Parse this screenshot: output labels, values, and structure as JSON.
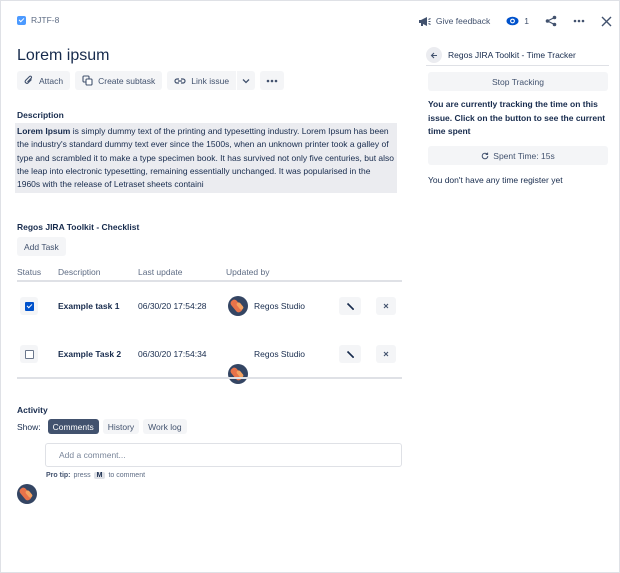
{
  "issue": {
    "key": "RJTF-8",
    "title": "Lorem ipsum"
  },
  "topbar": {
    "feedback_label": "Give feedback",
    "watch_count": "1"
  },
  "actions": {
    "attach": "Attach",
    "create_subtask": "Create subtask",
    "link_issue": "Link issue"
  },
  "description": {
    "heading": "Description",
    "bold_lead": "Lorem Ipsum",
    "body": " is simply dummy text of the printing and typesetting industry. Lorem Ipsum has been the industry's standard dummy text ever since the 1500s, when an unknown printer took a galley of type and scrambled it to make a type specimen book. It has survived not only five centuries, but also the leap into electronic typesetting, remaining essentially unchanged. It was popularised in the 1960s with the release of Letraset sheets containi"
  },
  "checklist": {
    "heading": "Regos JIRA Toolkit - Checklist",
    "add_task_label": "Add Task",
    "columns": [
      "Status",
      "Description",
      "Last update",
      "Updated by"
    ],
    "rows": [
      {
        "checked": true,
        "description": "Example task 1",
        "last_update": "06/30/20 17:54:28",
        "updated_by": "Regos Studio"
      },
      {
        "checked": false,
        "description": "Example Task 2",
        "last_update": "06/30/20 17:54:34",
        "updated_by": "Regos Studio"
      }
    ]
  },
  "activity": {
    "heading": "Activity",
    "show_label": "Show:",
    "tabs": [
      "Comments",
      "History",
      "Work log"
    ],
    "active_tab": "Comments",
    "comment_placeholder": "Add a comment...",
    "pro_tip_label": "Pro tip:",
    "pro_tip_press": "press",
    "pro_tip_key": "M",
    "pro_tip_suffix": "to comment"
  },
  "tracker": {
    "title": "Regos JIRA Toolkit - Time Tracker",
    "stop_label": "Stop Tracking",
    "message": "You are currently tracking the time on this issue. Click on the button to see the current time spent",
    "spent_label": "Spent Time: 15s",
    "no_time_text": "You don't have any time register yet"
  },
  "colors": {
    "accent": "#0052cc",
    "active_tab": "#42526e",
    "button_bg": "#f4f5f7"
  }
}
